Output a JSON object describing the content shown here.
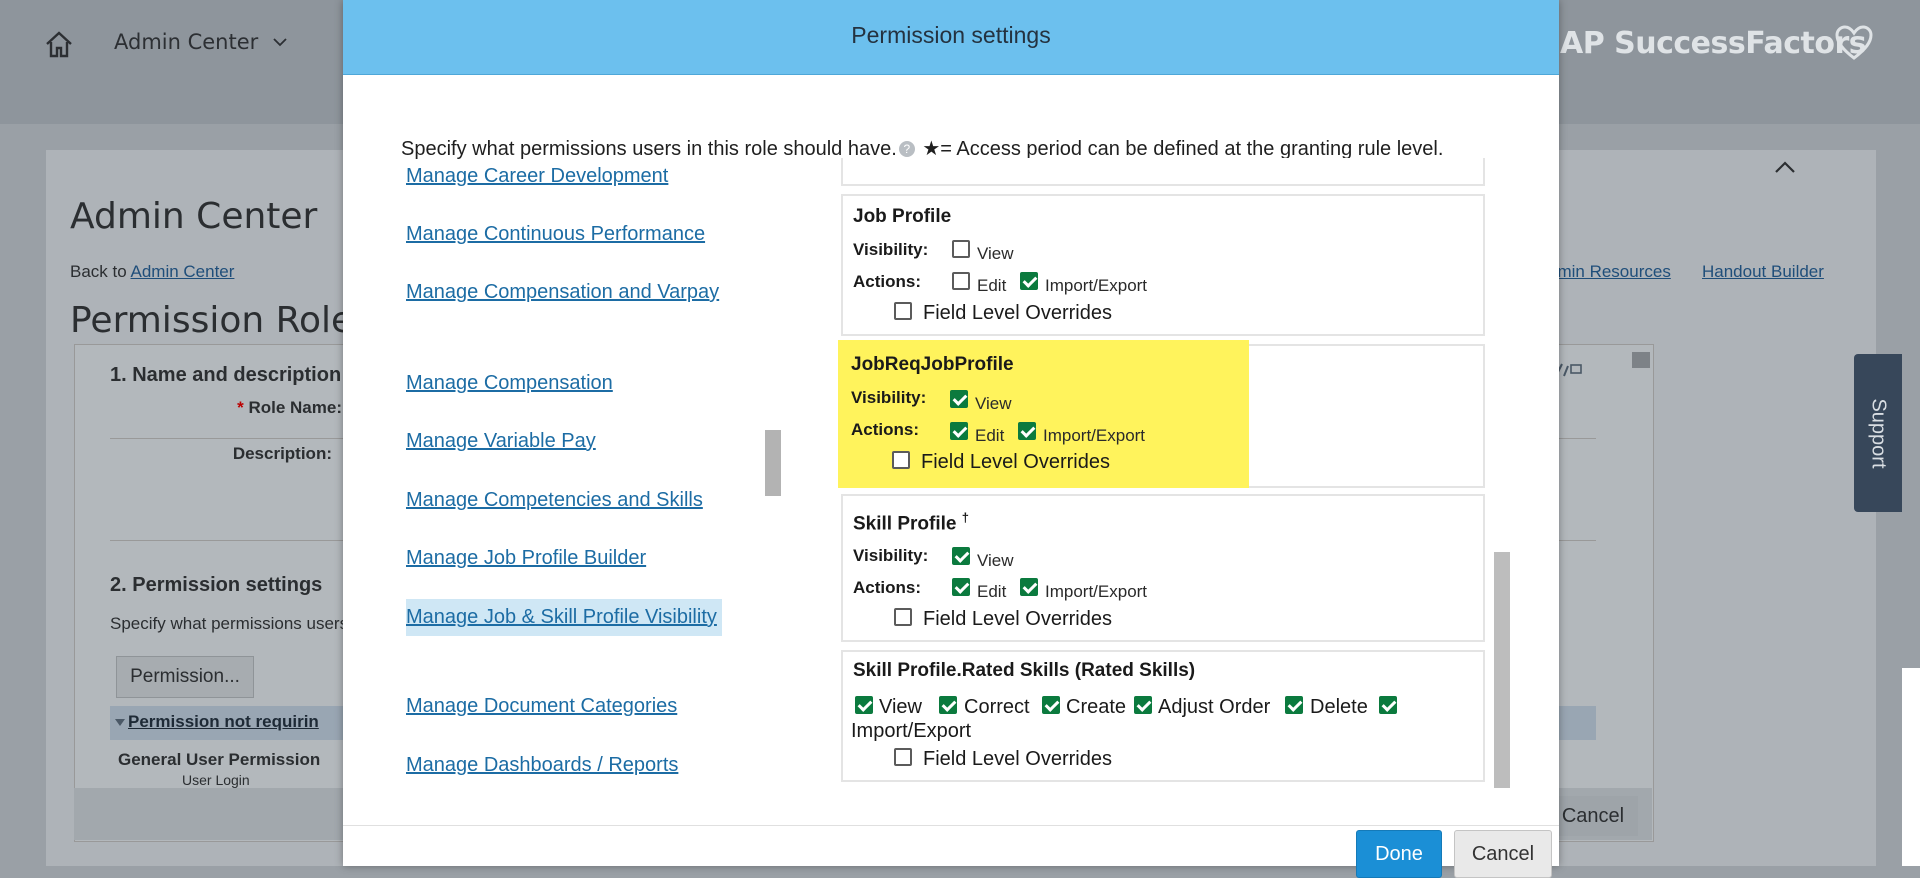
{
  "background": {
    "topbar": {
      "title": "Admin Center",
      "brand": "AP SuccessFactors"
    },
    "page_title": "Admin Center",
    "back_to_prefix": "Back to ",
    "back_to_link": "Admin Center",
    "resource_links": [
      "dmin Resources",
      "Handout Builder"
    ],
    "role_title": "Permission Role",
    "section1_title": "1. Name and description",
    "role_name_required_mark": "*",
    "role_name_label": "Role Name:",
    "description_label": "Description:",
    "section2_title": "2. Permission settings",
    "section2_text": "Specify what permissions users",
    "permission_button": "Permission...",
    "permission_not_requiring": "Permission not requirin",
    "general_user_permission": "General User Permission",
    "user_login": "User Login",
    "cancel_label": "Cancel",
    "support_label": "Support"
  },
  "modal": {
    "title": "Permission settings",
    "instruction_prefix": "Specify what permissions users in this role should have.",
    "help_glyph": "?",
    "instruction_suffix": " ★= Access period can be defined at the granting rule level.",
    "nav_items": [
      {
        "label": "Manage Career Development"
      },
      {
        "label": "Manage Continuous Performance"
      },
      {
        "label": "Manage Compensation and Varpay"
      },
      {
        "label": "Manage Compensation"
      },
      {
        "label": "Manage Variable Pay"
      },
      {
        "label": "Manage Competencies and Skills"
      },
      {
        "label": "Manage Job Profile Builder"
      },
      {
        "label": "Manage Job & Skill Profile Visibility"
      },
      {
        "label": "Manage Document Categories"
      },
      {
        "label": "Manage Dashboards / Reports"
      }
    ],
    "selected_nav": "Manage Job & Skill Profile Visibility",
    "labels": {
      "visibility": "Visibility:",
      "actions": "Actions:"
    },
    "boxes": [
      {
        "title": "Job Profile",
        "view": {
          "label": "View",
          "checked": false
        },
        "edit": {
          "label": "Edit",
          "checked": false
        },
        "import_export": {
          "label": "Import/Export",
          "checked": true
        },
        "flo": {
          "label": "Field Level Overrides",
          "checked": false
        }
      },
      {
        "title": "JobReqJobProfile",
        "highlighted": true,
        "view": {
          "label": "View",
          "checked": true
        },
        "edit": {
          "label": "Edit",
          "checked": true
        },
        "import_export": {
          "label": "Import/Export",
          "checked": true
        },
        "flo": {
          "label": "Field Level Overrides",
          "checked": false
        }
      },
      {
        "title": "Skill Profile",
        "superscript": "†",
        "view": {
          "label": "View",
          "checked": true
        },
        "edit": {
          "label": "Edit",
          "checked": true
        },
        "import_export": {
          "label": "Import/Export",
          "checked": true
        },
        "flo": {
          "label": "Field Level Overrides",
          "checked": false
        }
      },
      {
        "title": "Skill Profile.Rated Skills (Rated Skills)",
        "options": [
          {
            "label": "View",
            "checked": true
          },
          {
            "label": "Correct",
            "checked": true
          },
          {
            "label": "Create",
            "checked": true
          },
          {
            "label": "Adjust Order",
            "checked": true
          },
          {
            "label": "Delete",
            "checked": true
          },
          {
            "label": "Import/Export",
            "checked": true
          }
        ],
        "flo": {
          "label": "Field Level Overrides",
          "checked": false
        }
      }
    ],
    "done_label": "Done",
    "cancel_label": "Cancel"
  },
  "colors": {
    "header": "#6cc0ee",
    "highlight": "#fff35c",
    "link": "#1c6ca4",
    "selected_nav_bg": "#cfe7f5",
    "primary_button": "#1b8fd6",
    "checkbox_on": "#0b7a3e"
  }
}
